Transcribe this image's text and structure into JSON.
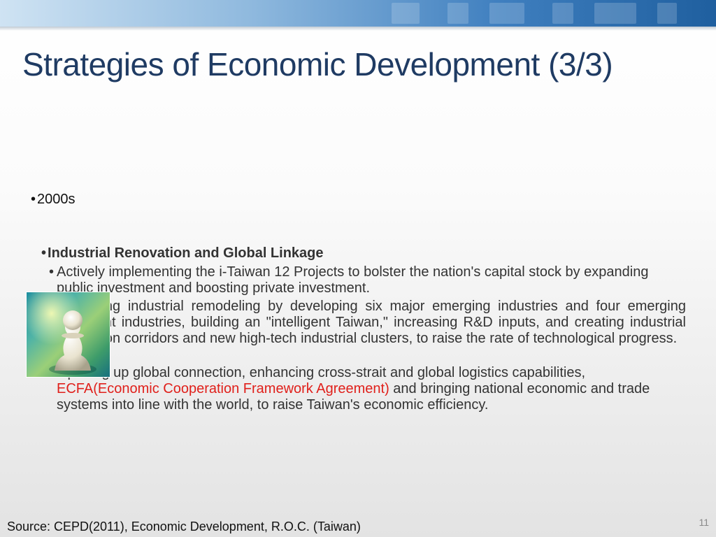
{
  "slide": {
    "title": "Strategies of Economic Development (3/3)",
    "era_bullet": "2000s",
    "section_heading": "Industrial Renovation and Global Linkage",
    "items": [
      {
        "text": "Actively implementing the i-Taiwan 12 Projects to bolster the nation's capital stock by expanding public investment and boosting private investment."
      },
      {
        "text": "Promoting industrial remodeling by developing six major emerging industries and four emerging intelligent industries, building an \"intelligent Taiwan,\" increasing R&D inputs, and creating industrial innovation corridors and new high-tech industrial clusters, to raise the rate of technological progress."
      },
      {
        "before": "Opening up global connection, enhancing cross-strait and global logistics capabilities, ",
        "highlight": "ECFA(Economic Cooperation Framework Agreement)",
        "after": " and bringing national economic and trade systems into line with the world, to raise Taiwan's economic efficiency."
      }
    ],
    "source": "Source: CEPD(2011), Economic Development, R.O.C. (Taiwan)",
    "page_number": "11",
    "highlight_color": "#e0201b",
    "title_color": "#1f3b63",
    "bullet_char": "•"
  }
}
